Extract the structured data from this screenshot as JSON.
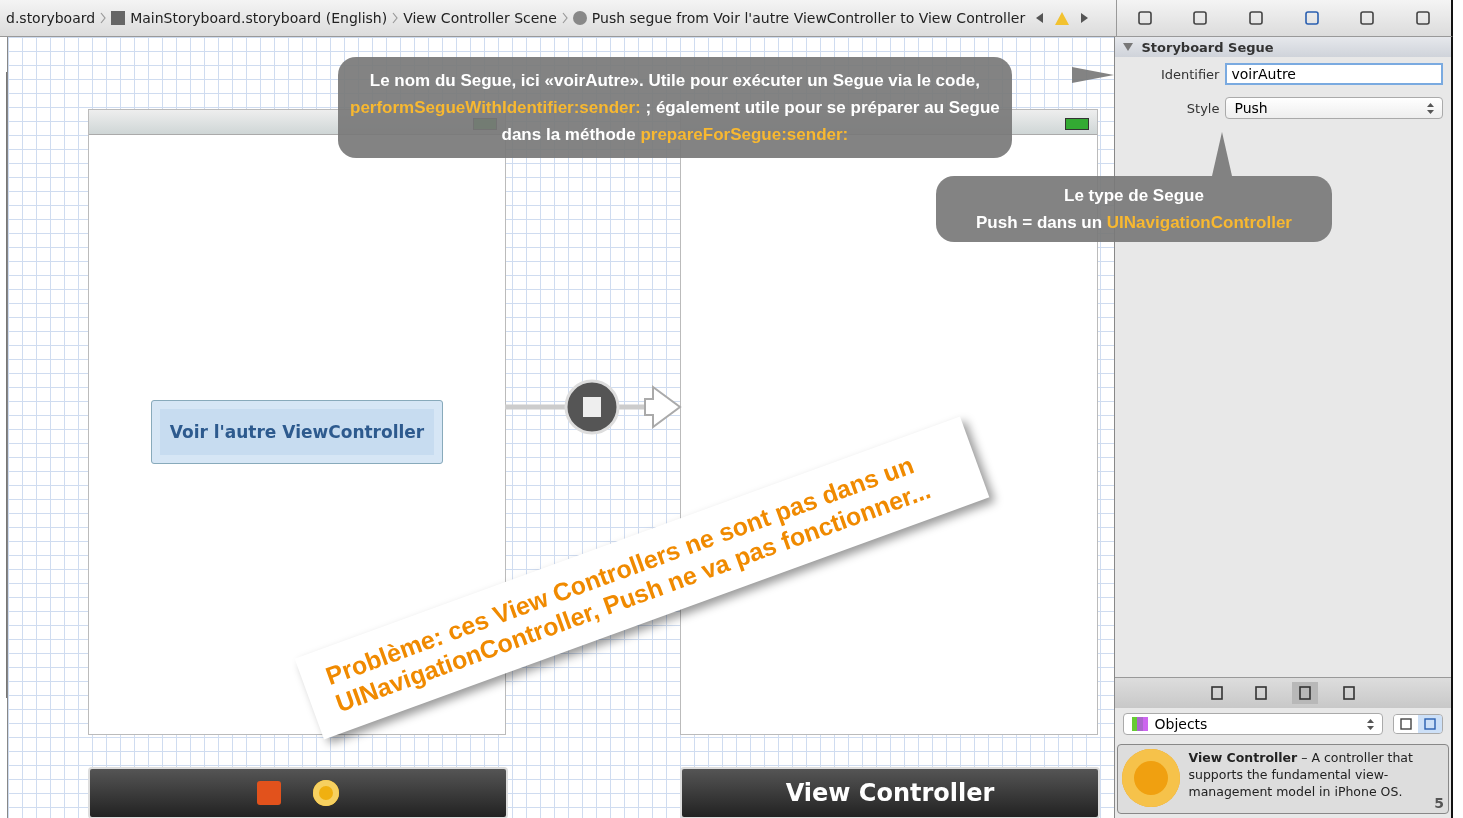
{
  "breadcrumbs": [
    "d.storyboard",
    "MainStoryboard.storyboard (English)",
    "View Controller Scene",
    "Push segue from Voir l'autre ViewController to View Controller"
  ],
  "inspector": {
    "tabs": [
      {
        "selected": false
      },
      {
        "selected": false
      },
      {
        "selected": false
      },
      {
        "selected": true
      },
      {
        "selected": false
      },
      {
        "selected": false
      }
    ],
    "section": {
      "title": "Storyboard Segue",
      "expanded": true
    },
    "identifier": {
      "label": "Identifier",
      "value": "voirAutre"
    },
    "style": {
      "label": "Style",
      "value": "Push"
    }
  },
  "callouts": [
    {
      "lines": [
        "Le nom du Segue, ici «voirAutre». Utile pour exécuter un Segue via le code,",
        "**performSegueWithIdentifier:sender:** ; également utile pour se préparer au Segue",
        "dans la méthode **prepareForSegue:sender:**"
      ]
    },
    {
      "lines": [
        "Le type de Segue",
        "Push = dans un **UINavigationController**"
      ]
    }
  ],
  "scene": {
    "button": "Voir l'autre ViewController",
    "destination_title": "View Controller"
  },
  "note": {
    "lines": [
      "Problème: ces View Controllers ne sont pas dans un",
      "UINavigationController, Push ne va pas fonctionner..."
    ]
  },
  "library": {
    "tabs": [
      {
        "selected": false
      },
      {
        "selected": false
      },
      {
        "selected": true
      },
      {
        "selected": false
      }
    ],
    "dropdown": "Objects",
    "view_modes": [
      {
        "selected": false
      },
      {
        "selected": true
      }
    ],
    "item": {
      "title": "View Controller",
      "description": "– A controller that supports the fundamental view-management model in iPhone OS."
    }
  },
  "page_number": "5"
}
